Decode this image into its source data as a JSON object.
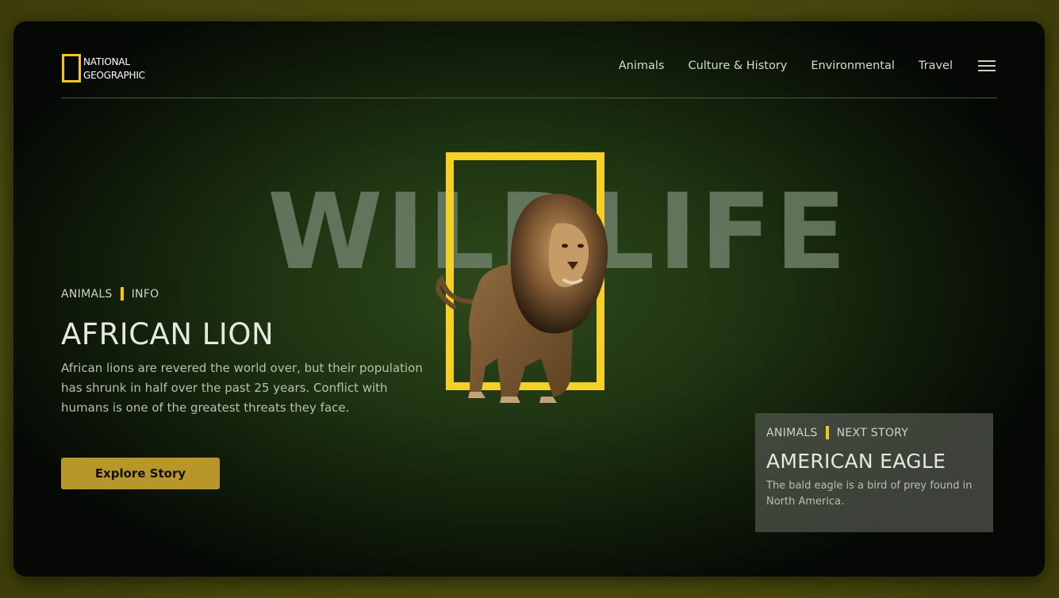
{
  "logo": {
    "line1": "NATIONAL",
    "line2": "GEOGRAPHIC"
  },
  "nav": {
    "items": [
      "Animals",
      "Culture & History",
      "Environmental",
      "Travel"
    ]
  },
  "hero": {
    "background_word": "WILDLIFE",
    "category": "ANIMALS",
    "tag": "INFO",
    "title": "AFRICAN LION",
    "description": "African lions are revered the world over, but their population has shrunk in half over the past 25 years. Conflict with humans is one of the greatest threats they face.",
    "cta_label": "Explore Story"
  },
  "next_story": {
    "category": "ANIMALS",
    "tag": "NEXT STORY",
    "title": "AMERICAN EAGLE",
    "description": "The bald eagle is a bird of prey found in North America."
  },
  "colors": {
    "accent": "#f5c518",
    "button": "#b8962a",
    "background": "#1f3512"
  }
}
